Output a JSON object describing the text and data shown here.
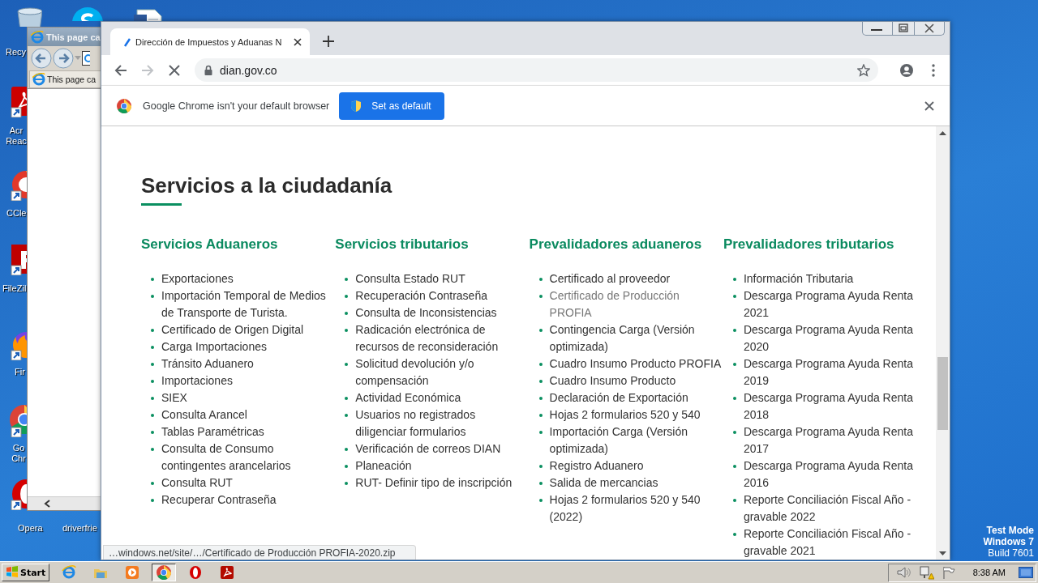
{
  "desktop": {
    "icons": [
      {
        "kind": "recycle",
        "label": "Recy"
      },
      {
        "kind": "skype"
      },
      {
        "kind": "document"
      },
      {
        "kind": "acrobat",
        "label": "Acr Reac"
      },
      {
        "kind": "ccleaner",
        "label": "CCle"
      },
      {
        "kind": "filezilla",
        "label": "FileZil"
      },
      {
        "kind": "firefox",
        "label": "Fir"
      },
      {
        "kind": "chrome",
        "label": "Go Chr"
      },
      {
        "kind": "opera",
        "label": "Opera"
      },
      {
        "kind": "blank",
        "label": "driverfrie"
      }
    ],
    "watermark": [
      "Test Mode",
      "Windows 7",
      "Build 7601"
    ]
  },
  "ie_window": {
    "title": "This page ca",
    "tab_title": "This page ca"
  },
  "chrome": {
    "tab": {
      "title": "Dirección de Impuestos y Aduanas N",
      "selected": true
    },
    "url": "dian.gov.co",
    "loading": true,
    "infobar": {
      "message": "Google Chrome isn't your default browser",
      "button": "Set as default"
    },
    "page": {
      "heading": "Servicios a la ciudadanía",
      "columns": [
        {
          "title": "Servicios Aduaneros",
          "items": [
            {
              "text": "Exportaciones",
              "hovered": false
            },
            {
              "text": "Importación Temporal de Medios de Transporte de Turista.",
              "hovered": false
            },
            {
              "text": "Certificado de Origen Digital",
              "hovered": false
            },
            {
              "text": "Carga Importaciones",
              "hovered": false
            },
            {
              "text": "Tránsito Aduanero",
              "hovered": false
            },
            {
              "text": "Importaciones",
              "hovered": false
            },
            {
              "text": "SIEX",
              "hovered": false
            },
            {
              "text": "Consulta Arancel",
              "hovered": false
            },
            {
              "text": "Tablas Paramétricas",
              "hovered": false
            },
            {
              "text": "Consulta de Consumo contingentes arancelarios",
              "hovered": false
            },
            {
              "text": "Consulta RUT",
              "hovered": false
            },
            {
              "text": "Recuperar Contraseña",
              "hovered": false
            }
          ]
        },
        {
          "title": "Servicios tributarios",
          "items": [
            {
              "text": "Consulta Estado RUT",
              "hovered": false
            },
            {
              "text": "Recuperación Contraseña",
              "hovered": false
            },
            {
              "text": "Consulta de Inconsistencias",
              "hovered": false
            },
            {
              "text": "Radicación electrónica de recursos de reconsideración",
              "hovered": false
            },
            {
              "text": "Solicitud devolución y/o compensación",
              "hovered": false
            },
            {
              "text": "Actividad Económica",
              "hovered": false
            },
            {
              "text": "Usuarios no registrados diligenciar formularios",
              "hovered": false
            },
            {
              "text": "Verificación de correos DIAN",
              "hovered": false
            },
            {
              "text": "Planeación",
              "hovered": false
            },
            {
              "text": "RUT- Definir tipo de inscripción",
              "hovered": false
            }
          ]
        },
        {
          "title": "Prevalidadores aduaneros",
          "items": [
            {
              "text": "Certificado al proveedor",
              "hovered": false
            },
            {
              "text": "Certificado de Producción PROFIA",
              "hovered": true
            },
            {
              "text": "Contingencia Carga (Versión optimizada)",
              "hovered": false
            },
            {
              "text": "Cuadro Insumo Producto PROFIA",
              "hovered": false
            },
            {
              "text": "Cuadro Insumo Producto",
              "hovered": false
            },
            {
              "text": "Declaración de Exportación",
              "hovered": false
            },
            {
              "text": "Hojas 2 formularios 520 y 540",
              "hovered": false
            },
            {
              "text": "Importación Carga (Versión optimizada)",
              "hovered": false
            },
            {
              "text": "Registro Aduanero",
              "hovered": false
            },
            {
              "text": "Salida de mercancias",
              "hovered": false
            },
            {
              "text": "Hojas 2 formularios 520 y 540 (2022)",
              "hovered": false
            }
          ]
        },
        {
          "title": "Prevalidadores tributarios",
          "items": [
            {
              "text": "Información Tributaria",
              "hovered": false
            },
            {
              "text": "Descarga Programa Ayuda Renta 2021",
              "hovered": false
            },
            {
              "text": "Descarga Programa Ayuda Renta 2020",
              "hovered": false
            },
            {
              "text": "Descarga Programa Ayuda Renta 2019",
              "hovered": false
            },
            {
              "text": "Descarga Programa Ayuda Renta 2018",
              "hovered": false
            },
            {
              "text": "Descarga Programa Ayuda Renta 2017",
              "hovered": false
            },
            {
              "text": "Descarga Programa Ayuda Renta 2016",
              "hovered": false
            },
            {
              "text": "Reporte Conciliación Fiscal Año - gravable 2022",
              "hovered": false
            },
            {
              "text": "Reporte Conciliación Fiscal Año - gravable 2021",
              "hovered": false
            }
          ]
        }
      ]
    },
    "status_url": "…windows.net/site/…/Certificado de Producción PROFIA-2020.zip"
  },
  "taskbar": {
    "start": "Start",
    "apps": [
      {
        "kind": "ie",
        "selected": false
      },
      {
        "kind": "explorer",
        "selected": false
      },
      {
        "kind": "media",
        "selected": false
      },
      {
        "kind": "chrome",
        "selected": true
      },
      {
        "kind": "opera",
        "selected": false
      },
      {
        "kind": "acrobat",
        "selected": false
      }
    ],
    "clock": "8:38 AM"
  }
}
